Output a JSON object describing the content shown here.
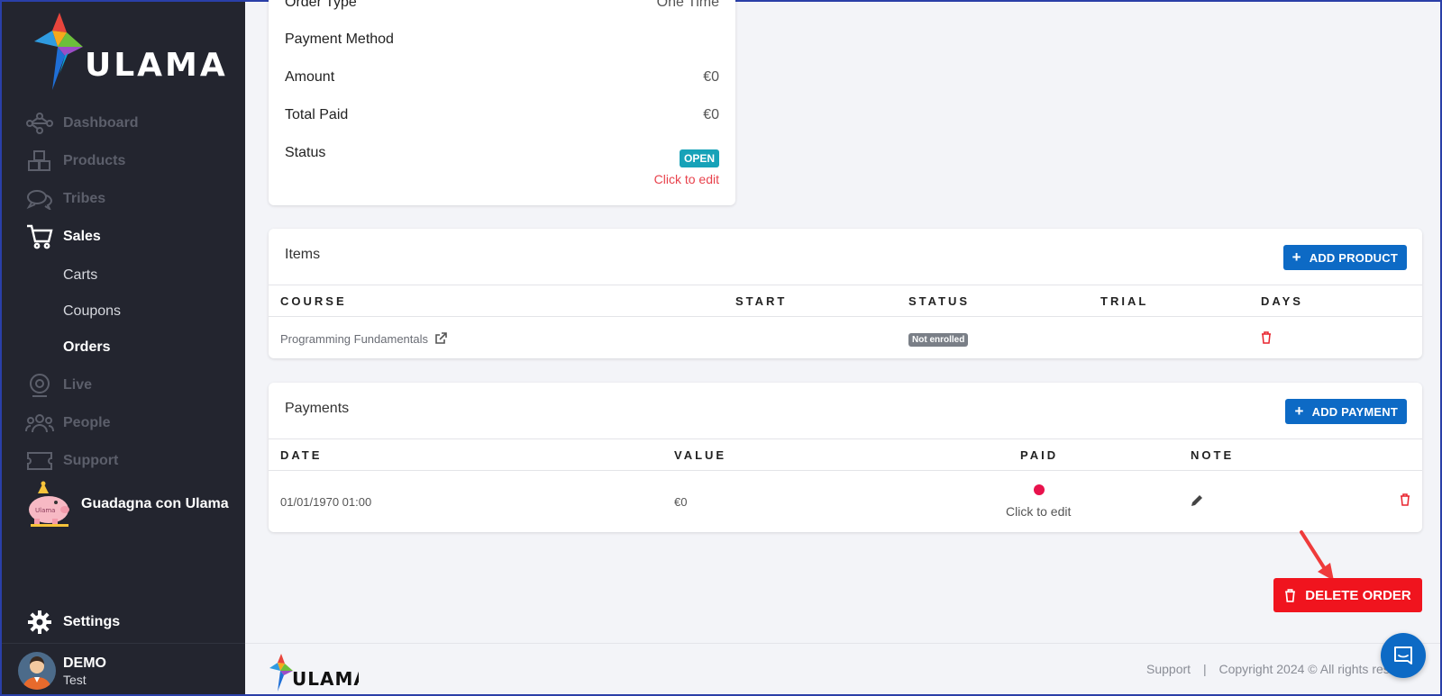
{
  "sidebar": {
    "logo_text": "ULAMA",
    "nav": [
      {
        "label": "Dashboard",
        "icon": "network-icon"
      },
      {
        "label": "Products",
        "icon": "cubes-icon"
      },
      {
        "label": "Tribes",
        "icon": "chat-icon"
      },
      {
        "label": "Sales",
        "icon": "cart-icon"
      },
      {
        "label": "Live",
        "icon": "webcam-icon"
      },
      {
        "label": "People",
        "icon": "people-icon"
      },
      {
        "label": "Support",
        "icon": "ticket-icon"
      }
    ],
    "sales_sub": [
      "Carts",
      "Coupons",
      "Orders"
    ],
    "promo_label": "Guadagna con Ulama",
    "promo_sign": "Ulama",
    "settings_label": "Settings",
    "user": {
      "name": "DEMO",
      "sub": "Test"
    }
  },
  "summary": {
    "order_type_label": "Order Type",
    "order_type_value": "One Time",
    "payment_method_label": "Payment Method",
    "amount_label": "Amount",
    "amount_value": "€0",
    "total_paid_label": "Total Paid",
    "total_paid_value": "€0",
    "status_label": "Status",
    "status_badge": "OPEN",
    "status_edit": "Click to edit"
  },
  "items": {
    "title": "Items",
    "add_button": "ADD PRODUCT",
    "columns": [
      "COURSE",
      "START",
      "STATUS",
      "TRIAL",
      "DAYS"
    ],
    "rows": [
      {
        "course": "Programming Fundamentals",
        "status": "Not enrolled"
      }
    ]
  },
  "payments": {
    "title": "Payments",
    "add_button": "ADD PAYMENT",
    "columns": [
      "DATE",
      "VALUE",
      "PAID",
      "NOTE"
    ],
    "rows": [
      {
        "date": "01/01/1970 01:00",
        "value": "€0",
        "paid_edit": "Click to edit"
      }
    ]
  },
  "delete_order_label": "DELETE ORDER",
  "footer": {
    "logo_text": "ULAMA",
    "support": "Support",
    "separator": "|",
    "copyright": "Copyright 2024 © All rights res"
  },
  "colors": {
    "sidebar_bg": "#23252f",
    "primary_blue": "#0d6ac5",
    "danger_red": "#f0141e",
    "open_badge": "#17a2b8",
    "paid_dot": "#e8124c"
  }
}
